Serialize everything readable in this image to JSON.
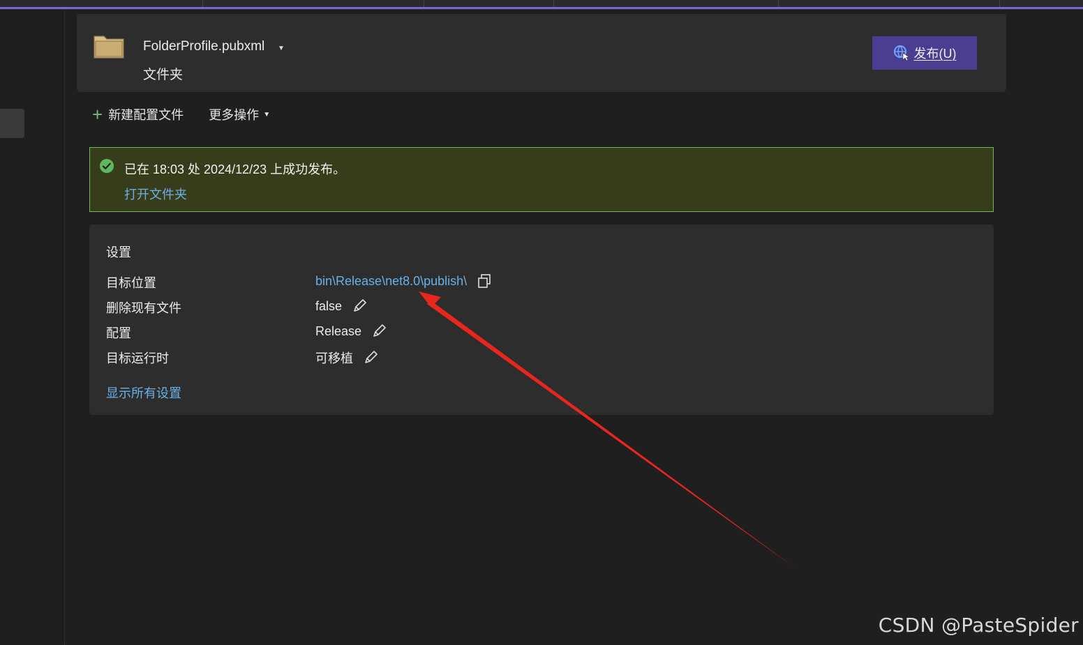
{
  "header": {
    "profile_name": "FolderProfile.pubxml",
    "profile_type": "文件夹",
    "publish_label": "发布(U)"
  },
  "actions": {
    "new_profile": "新建配置文件",
    "more_actions": "更多操作"
  },
  "banner": {
    "message": "已在 18:03 处 2024/12/23 上成功发布。",
    "open_folder": "打开文件夹"
  },
  "settings": {
    "title": "设置",
    "rows": [
      {
        "key": "目标位置",
        "value": "bin\\Release\\net8.0\\publish\\"
      },
      {
        "key": "删除现有文件",
        "value": "false"
      },
      {
        "key": "配置",
        "value": "Release"
      },
      {
        "key": "目标运行时",
        "value": "可移植"
      }
    ],
    "show_all": "显示所有设置"
  },
  "watermark": "CSDN @PasteSpider",
  "colors": {
    "publish_button": "#4a3d92",
    "success_bg": "#373c1b",
    "success_border": "#6bbf4f",
    "link": "#6ab0e6",
    "annotation_arrow": "#e8261e"
  }
}
